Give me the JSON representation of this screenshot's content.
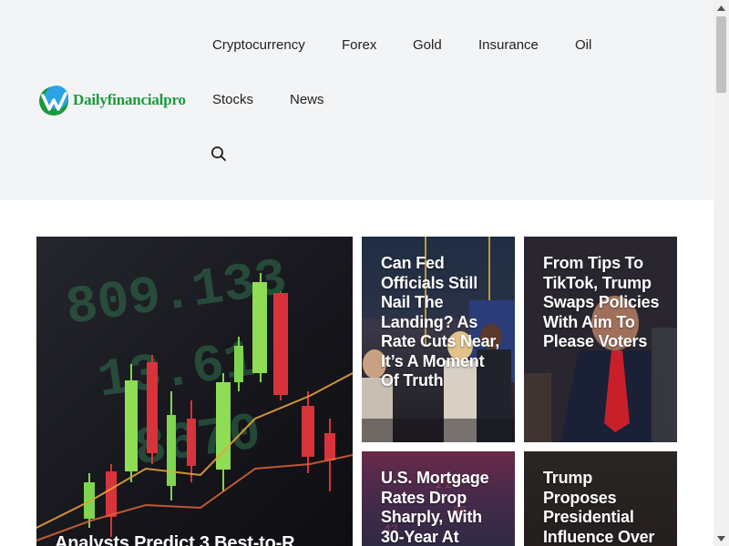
{
  "site": {
    "brand": "Dailyfinancialpro",
    "colors": {
      "brand_green": "#1a9a3c",
      "header_bg": "#f3f4f6",
      "nav_text": "#222222"
    }
  },
  "nav": {
    "items": [
      {
        "label": "Cryptocurrency"
      },
      {
        "label": "Forex"
      },
      {
        "label": "Gold"
      },
      {
        "label": "Insurance"
      },
      {
        "label": "Oil"
      },
      {
        "label": "Stocks"
      },
      {
        "label": "News"
      }
    ],
    "search_icon": "search-icon"
  },
  "posts": [
    {
      "title": "Analysts Predict 3 Best-to-R"
    },
    {
      "title": "Can Fed Officials Still Nail The Landing? As Rate Cuts Near, It’s A Moment Of Truth"
    },
    {
      "title": "From Tips To TikTok, Trump Swaps Policies With Aim To Please Voters"
    },
    {
      "title": "U.S. Mortgage Rates Drop Sharply, With 30-Year At"
    },
    {
      "title": "Trump Proposes Presidential Influence Over"
    }
  ]
}
